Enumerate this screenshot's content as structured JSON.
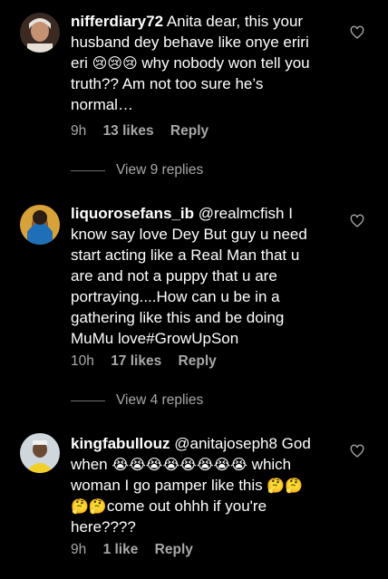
{
  "comments": [
    {
      "username": "nifferdiary72",
      "text": " Anita dear, this your husband dey behave like onye eriri eri ",
      "emojis": "😢😢😢",
      "text2": " why nobody won tell you truth?? Am not too sure he’s normal…",
      "time": "9h",
      "likes": "13 likes",
      "reply": "Reply",
      "view_replies": "View 9 replies"
    },
    {
      "username": "liquorosefans_ib",
      "text": " @realmcfish I know say love Dey But guy u need start acting like a Real Man that u are and not a puppy that u are portraying....How can u be in a gathering like this and be doing MuMu love#GrowUpSon",
      "time": "10h",
      "likes": "17 likes",
      "reply": "Reply",
      "view_replies": "View 4 replies"
    },
    {
      "username": "kingfabullouz",
      "text": " @anitajoseph8 God when ",
      "emojis": "😭😭😭😭😭😭😭😭",
      "text2": " which woman I go pamper like this ",
      "emojis2": "🤔🤔🤔🤔",
      "text3": "come out ohhh if you're here????",
      "time": "9h",
      "likes": "1 like",
      "reply": "Reply"
    }
  ],
  "icons": {
    "like": "heart-outline-icon"
  },
  "colors": {
    "background": "#000000",
    "text": "#ffffff",
    "muted": "#a8a8a8"
  }
}
